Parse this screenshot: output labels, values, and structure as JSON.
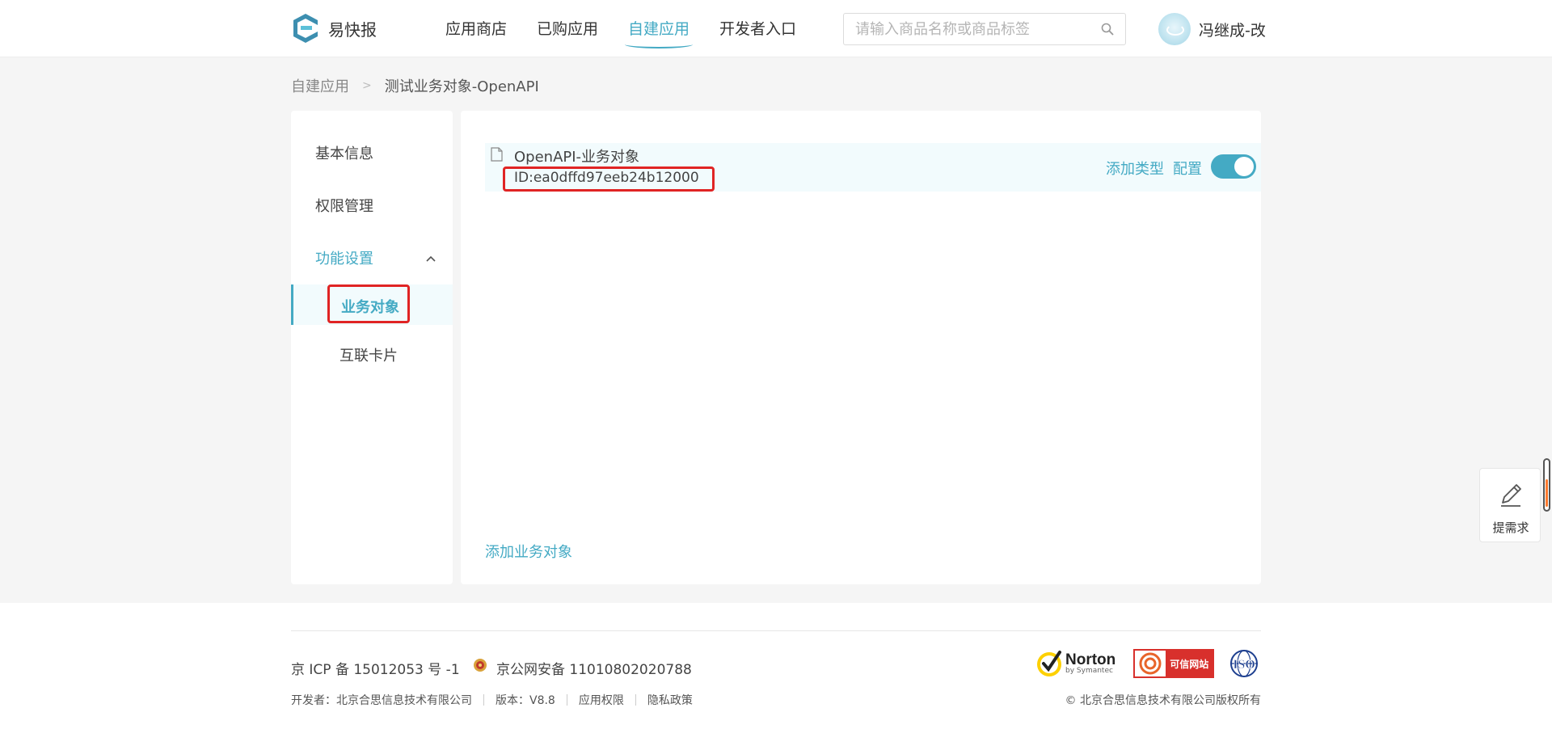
{
  "header": {
    "brand": "易快报",
    "nav": [
      "应用商店",
      "已购应用",
      "自建应用",
      "开发者入口"
    ],
    "active_nav": "自建应用",
    "search_placeholder": "请输入商品名称或商品标签",
    "user_name": "冯继成-改"
  },
  "breadcrumb": {
    "parent": "自建应用",
    "separator": ">",
    "current": "测试业务对象-OpenAPI"
  },
  "sidebar": {
    "items": [
      "基本信息",
      "权限管理"
    ],
    "group": "功能设置",
    "sub_items": [
      "业务对象",
      "互联卡片"
    ],
    "active_sub": "业务对象"
  },
  "main": {
    "object_name": "OpenAPI-业务对象",
    "object_id": "ID:ea0dffd97eeb24b12000",
    "add_type": "添加类型",
    "configure": "配置",
    "toggle_on": true,
    "add_object": "添加业务对象"
  },
  "feedback": {
    "label": "提需求"
  },
  "footer": {
    "icp": "京 ICP 备 15012053 号 -1",
    "police": "京公网安备 11010802020788",
    "developer": "开发者：北京合思信息技术有限公司",
    "version": "版本：V8.8",
    "app_permissions": "应用权限",
    "privacy": "隐私政策",
    "copyright": "© 北京合思信息技术有限公司版权所有",
    "norton_brand": "Norton",
    "norton_sub": "by Symantec",
    "trust_badge": "可信网站",
    "iso": "ISO"
  },
  "colors": {
    "accent": "#44aac4",
    "highlight": "#e02424",
    "background": "#f5f5f5"
  }
}
